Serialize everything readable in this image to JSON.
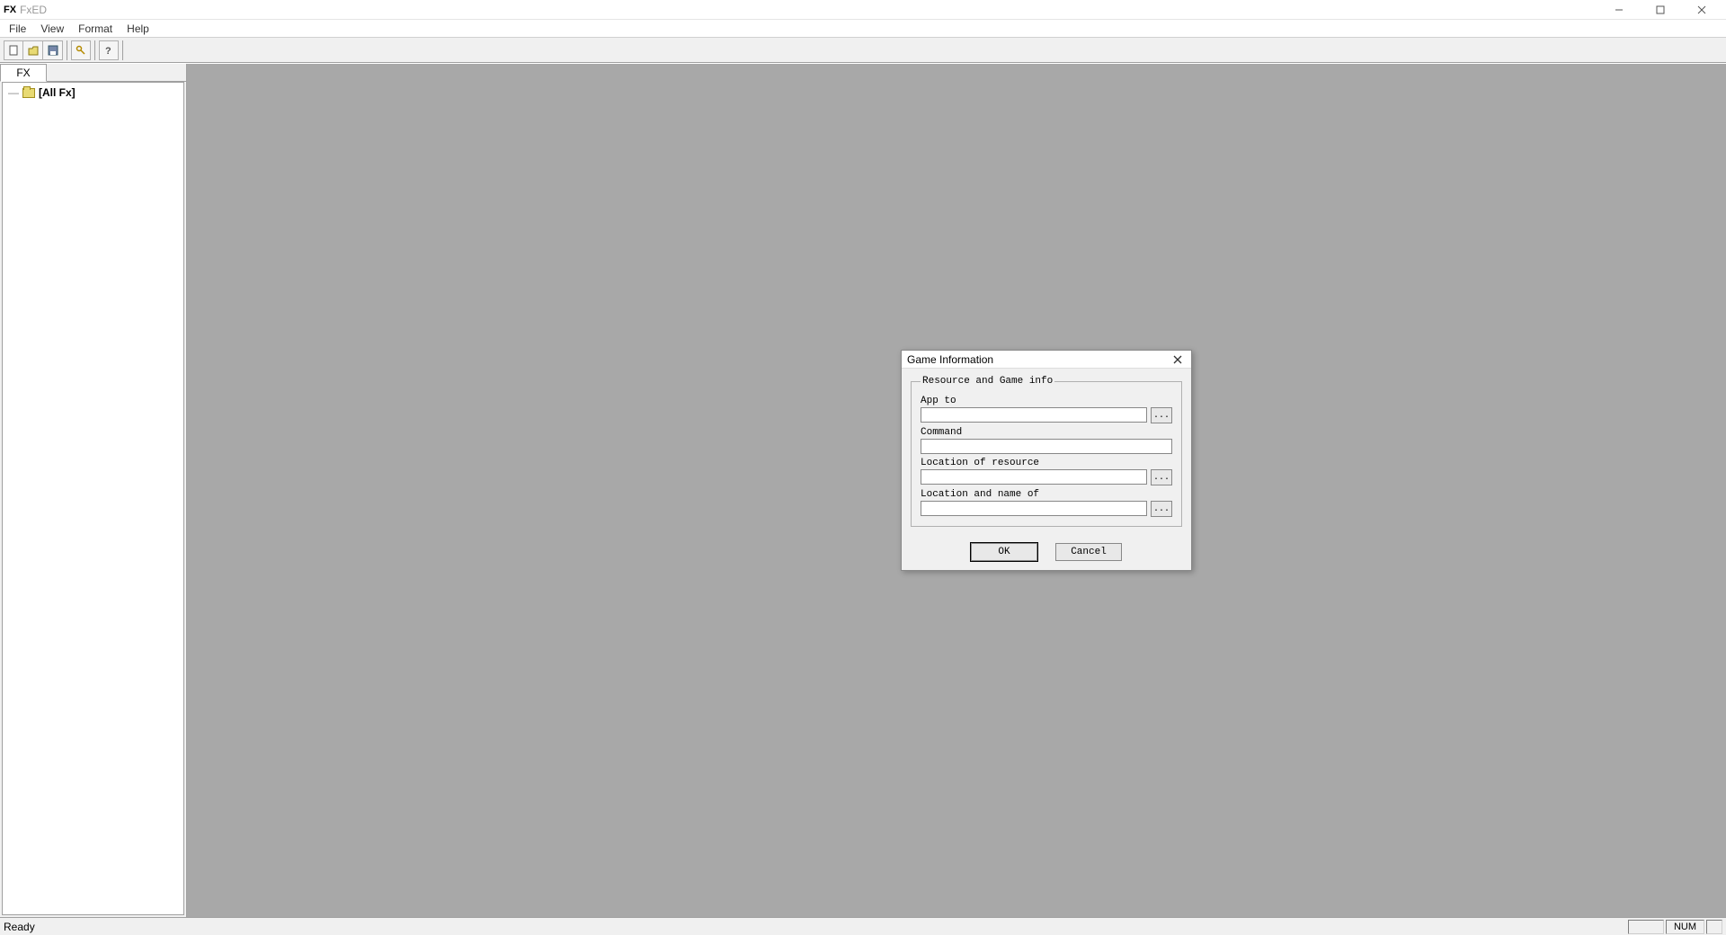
{
  "titlebar": {
    "app_icon": "FX",
    "title": "FxED"
  },
  "menubar": {
    "items": [
      "File",
      "View",
      "Format",
      "Help"
    ]
  },
  "toolbar": {
    "icons": [
      "new-file-icon",
      "open-file-icon",
      "save-file-icon",
      "key-icon",
      "help-icon"
    ]
  },
  "side": {
    "tab_label": "FX",
    "tree_root": "[All Fx]"
  },
  "statusbar": {
    "left": "Ready",
    "num": "NUM"
  },
  "dialog": {
    "title": "Game Information",
    "group_legend": "Resource and Game info",
    "fields": {
      "app_to_label": "App to",
      "app_to_value": "",
      "command_label": "Command",
      "command_value": "",
      "location_resource_label": "Location of resource",
      "location_resource_value": "",
      "location_name_label": "Location and name of",
      "location_name_value": ""
    },
    "browse_label": "...",
    "ok_label": "OK",
    "cancel_label": "Cancel"
  }
}
